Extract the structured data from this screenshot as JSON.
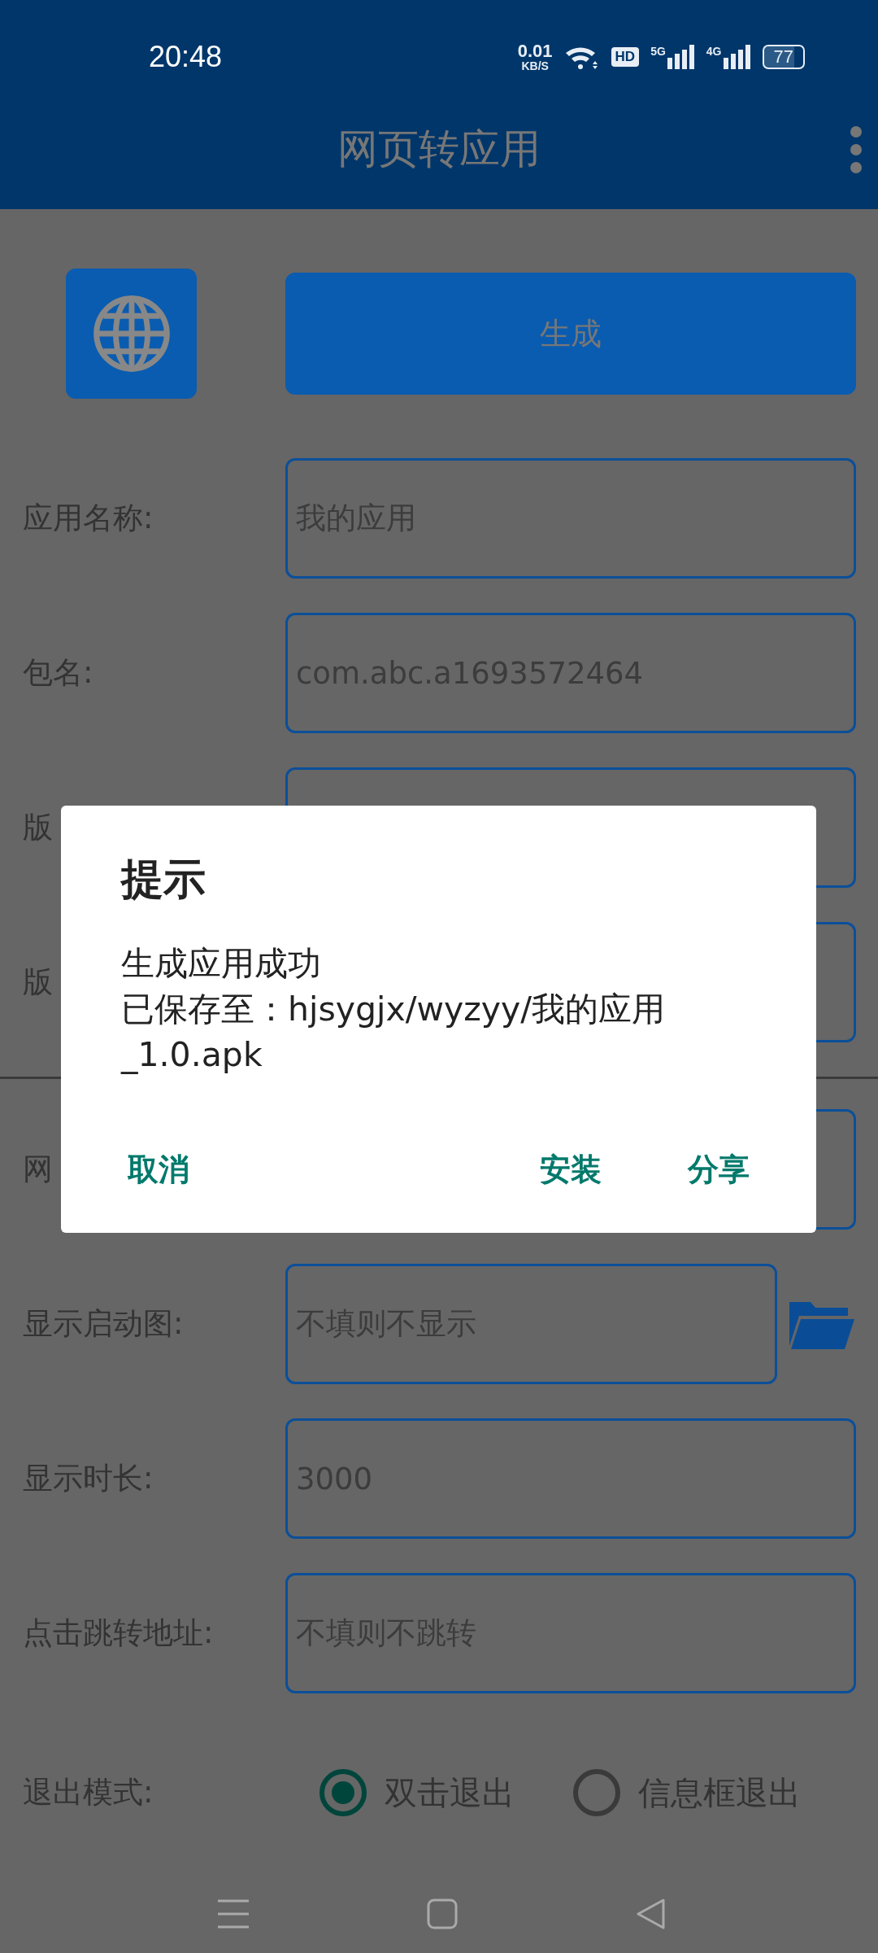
{
  "status_bar": {
    "time": "20:48",
    "speed": "0.01",
    "speed_unit": "KB/S",
    "hd": "HD",
    "networks": [
      "5G",
      "4G"
    ],
    "battery": "77"
  },
  "app_bar": {
    "title": "网页转应用"
  },
  "generate_button": {
    "label": "生成"
  },
  "sections": [
    {
      "rows": [
        {
          "kind": "field",
          "label": "应用名称:",
          "value": "我的应用"
        },
        {
          "kind": "field",
          "label": "包名:",
          "value": "com.abc.a1693572464"
        },
        {
          "kind": "field",
          "label": "版"
        },
        {
          "kind": "field",
          "label": "版"
        }
      ]
    },
    {
      "rows": [
        {
          "kind": "field",
          "label": "网"
        },
        {
          "kind": "file",
          "label": "显示启动图:",
          "placeholder": "不填则不显示"
        },
        {
          "kind": "field",
          "label": "显示时长:",
          "value": "3000"
        },
        {
          "kind": "field",
          "label": "点击跳转地址:",
          "placeholder": "不填则不跳转"
        }
      ]
    }
  ],
  "exit_mode": {
    "label": "退出模式:",
    "options": [
      {
        "label": "双击退出",
        "selected": true
      },
      {
        "label": "信息框退出",
        "selected": false
      }
    ]
  },
  "dialog": {
    "title": "提示",
    "message": [
      "生成应用成功",
      "已保存至：hjsygjx/wyzyy/我的应用",
      "_1.0.apk"
    ],
    "buttons": [
      "取消",
      "安装",
      "分享"
    ]
  }
}
